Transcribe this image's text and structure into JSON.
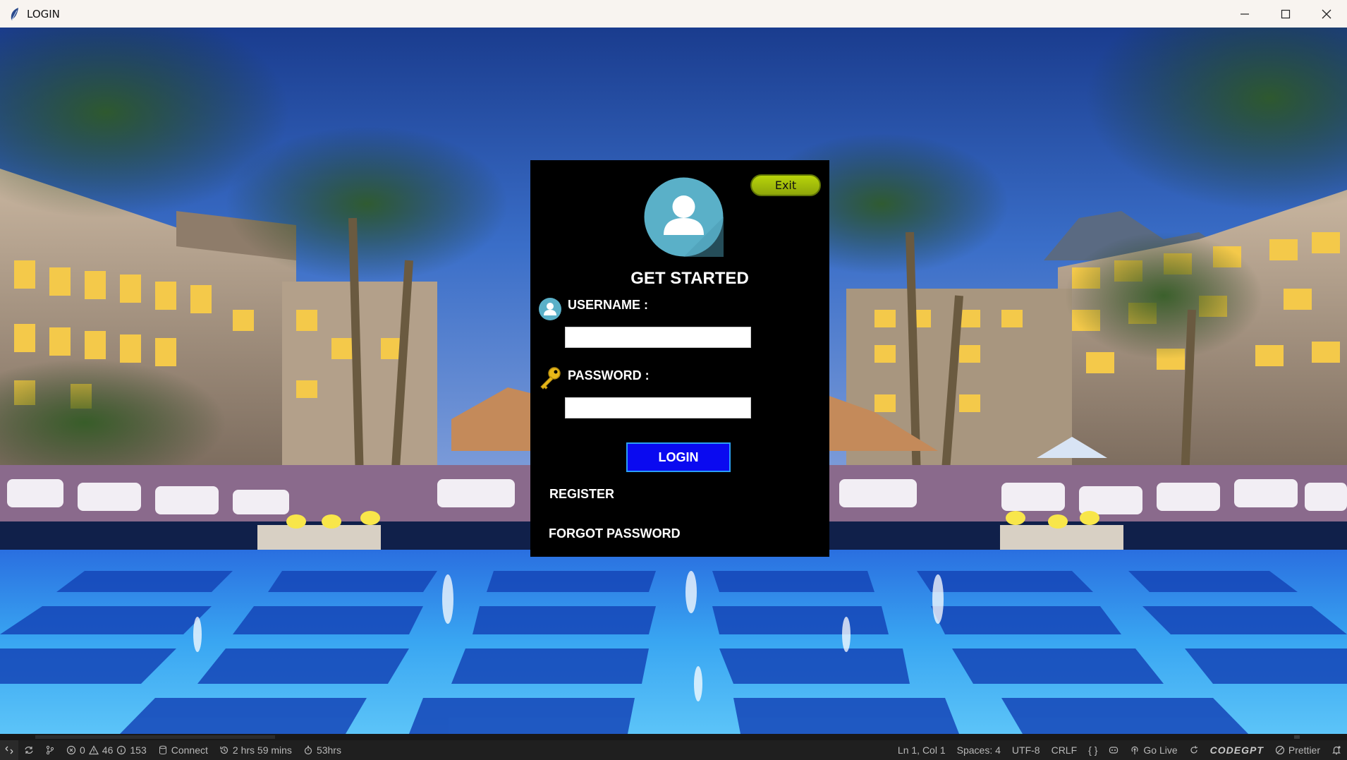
{
  "window": {
    "title": "LOGIN",
    "icon": "feather-icon",
    "controls": [
      "minimize-icon",
      "maximize-icon",
      "close-icon"
    ]
  },
  "login": {
    "exit_label": "Exit",
    "heading": "GET STARTED",
    "username_label": "USERNAME :",
    "username_value": "",
    "password_label": "PASSWORD :",
    "password_value": "",
    "login_label": "LOGIN",
    "register_label": "REGISTER",
    "forgot_label": "FORGOT PASSWORD"
  },
  "statusbar": {
    "errors": "0",
    "warnings": "46",
    "info": "153",
    "connect": "Connect",
    "session_time": "2 hrs 59 mins",
    "total_time": "53hrs",
    "cursor": "Ln 1, Col 1",
    "spaces": "Spaces: 4",
    "encoding": "UTF-8",
    "eol": "CRLF",
    "language_braces": "{ }",
    "go_live": "Go Live",
    "codegpt": "CODEGPT",
    "prettier": "Prettier"
  },
  "colors": {
    "panel_bg": "#000000",
    "login_button": "#0a0af0",
    "exit_button": "#a8c40a",
    "avatar": "#5ab0c8",
    "statusbar_bg": "#1f1f1f"
  }
}
